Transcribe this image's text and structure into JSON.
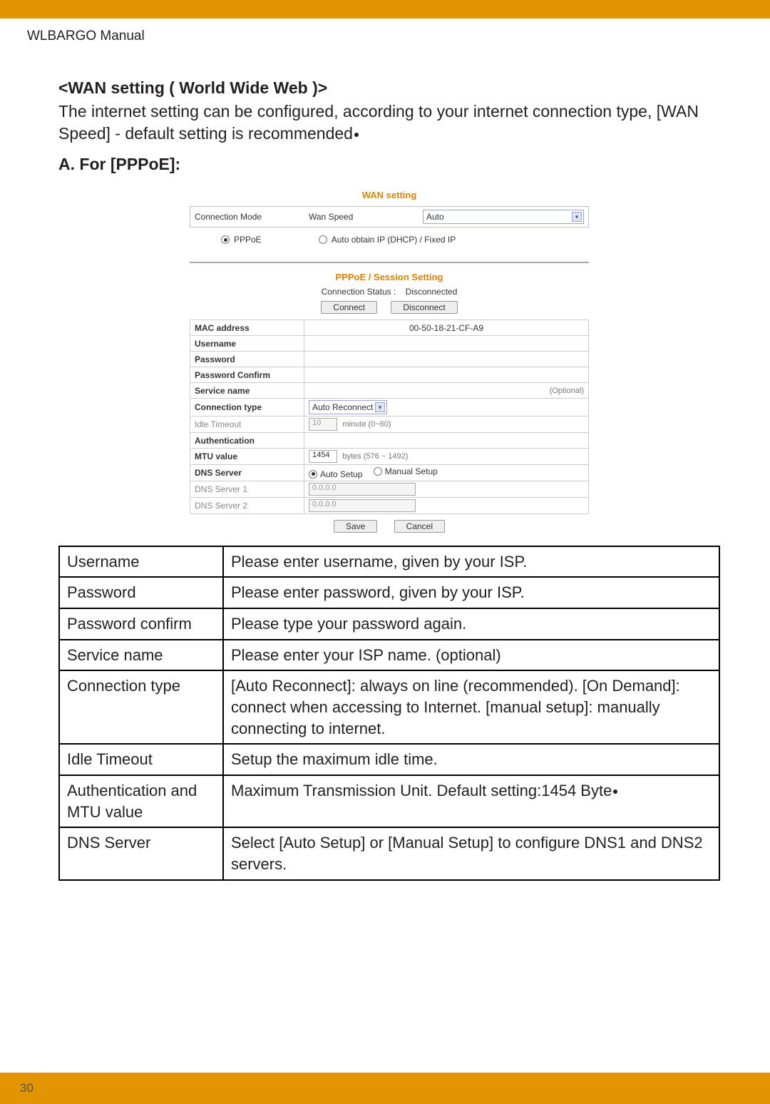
{
  "header": {
    "manual_title": "WLBARGO Manual",
    "page_number": "30"
  },
  "section": {
    "title": "<WAN setting ( World Wide Web )>",
    "intro": "The internet setting can be configured, according to your internet connection type, [WAN Speed] - default setting is recommended",
    "subA": "A. For [PPPoE]:"
  },
  "ui": {
    "wan_title": "WAN setting",
    "conn_mode_label": "Connection Mode",
    "wan_speed_label": "Wan Speed",
    "wan_speed_value": "Auto",
    "radio1": "PPPoE",
    "radio2": "Auto obtain IP (DHCP) / Fixed IP",
    "session_title": "PPPoE / Session Setting",
    "status_label": "Connection Status :",
    "status_value": "Disconnected",
    "btn_connect": "Connect",
    "btn_disconnect": "Disconnect",
    "rows": {
      "mac_label": "MAC address",
      "mac_value": "00-50-18-21-CF-A9",
      "username_label": "Username",
      "password_label": "Password",
      "password_confirm_label": "Password Confirm",
      "service_name_label": "Service name",
      "service_hint": "(Optional)",
      "conn_type_label": "Connection type",
      "conn_type_value": "Auto Reconnect",
      "idle_label": "Idle Timeout",
      "idle_value": "10",
      "idle_hint": "minute (0~60)",
      "auth_label": "Authentication",
      "mtu_label": "MTU value",
      "mtu_value": "1454",
      "mtu_hint": "bytes (576 ~ 1492)",
      "dns_label": "DNS Server",
      "dns_auto": "Auto Setup",
      "dns_manual": "Manual Setup",
      "dns1_label": "DNS Server 1",
      "dns1_value": "0.0.0.0",
      "dns2_label": "DNS Server 2",
      "dns2_value": "0.0.0.0"
    },
    "btn_save": "Save",
    "btn_cancel": "Cancel"
  },
  "desc": {
    "rows": [
      {
        "k": "Username",
        "v": "Please enter username, given by your ISP."
      },
      {
        "k": "Password",
        "v": "Please enter password, given by your ISP."
      },
      {
        "k": "Password confirm",
        "v": "Please type your password again."
      },
      {
        "k": "Service name",
        "v": "Please enter your ISP name. (optional)"
      },
      {
        "k": "Connection type",
        "v": "[Auto Reconnect]:  always on line (recommended). [On Demand]: connect when accessing to Internet. [manual setup]: manually connecting to internet."
      },
      {
        "k": "Idle Timeout",
        "v": "Setup the maximum idle time."
      },
      {
        "k": "Authentication and MTU value",
        "v": "Maximum Transmission Unit. Default setting:1454 Byte"
      },
      {
        "k": "DNS Server",
        "v": "Select [Auto Setup] or [Manual Setup] to configure DNS1 and DNS2 servers."
      }
    ]
  }
}
